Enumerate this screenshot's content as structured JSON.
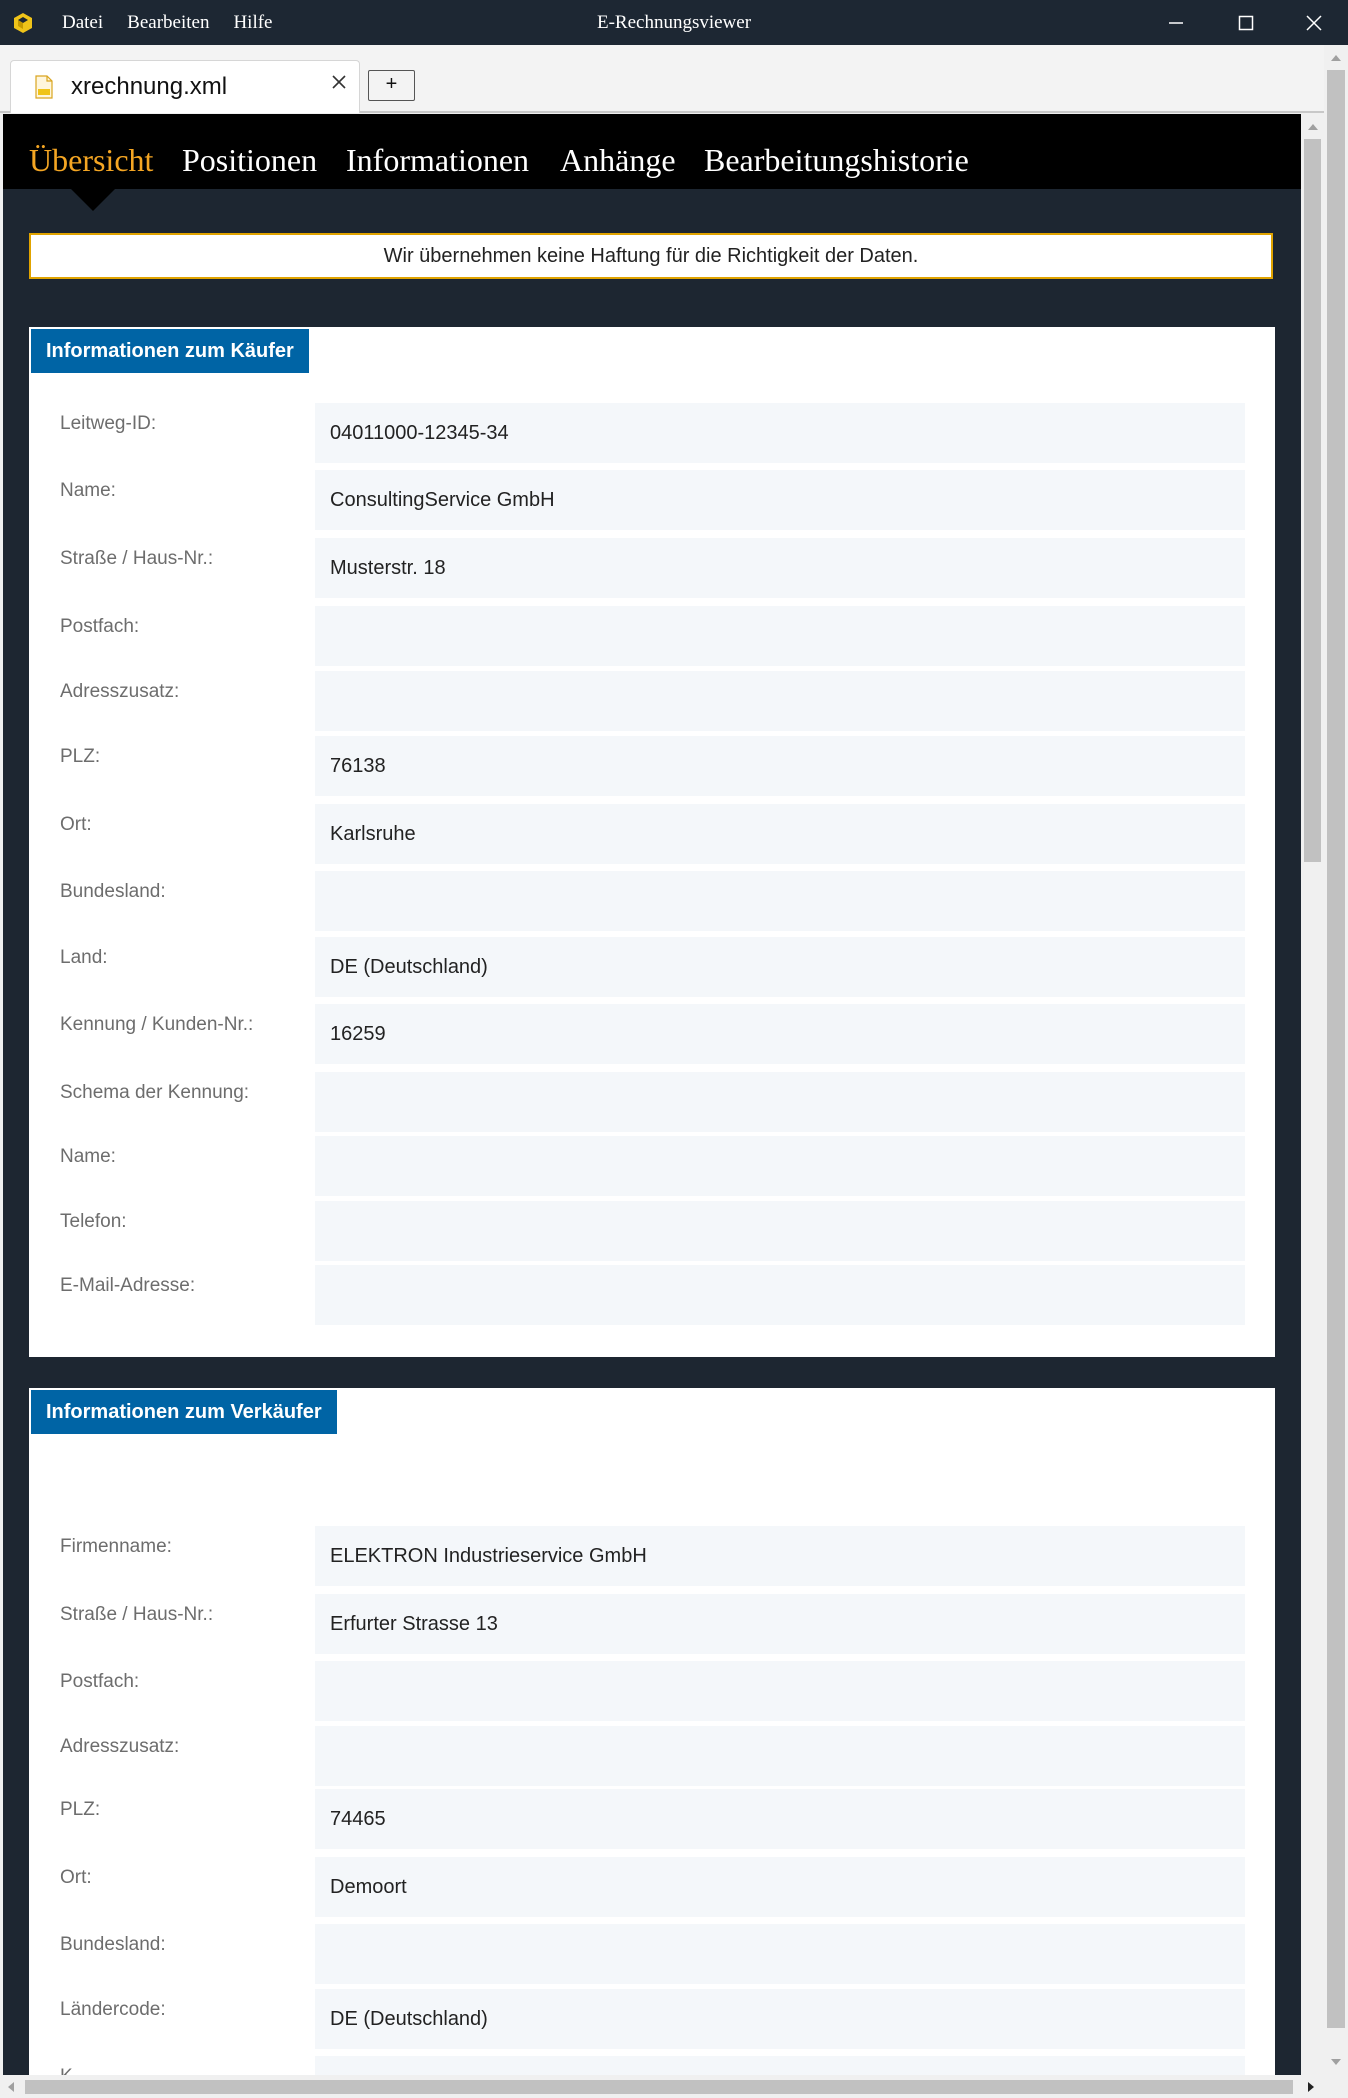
{
  "window": {
    "title": "E-Rechnungsviewer",
    "menu": [
      "Datei",
      "Bearbeiten",
      "Hilfe"
    ]
  },
  "tabs": {
    "file_tab": "xrechnung.xml",
    "add_label": "+"
  },
  "nav": {
    "items": [
      "Übersicht",
      "Positionen",
      "Informationen",
      "Anhänge",
      "Bearbeitungshistorie"
    ],
    "active": "Übersicht",
    "accent_color": "#f5a623"
  },
  "disclaimer": "Wir übernehmen keine Haftung für die Richtigkeit der Daten.",
  "buyer": {
    "title": "Informationen zum Käufer",
    "rows": [
      {
        "label": "Leitweg-ID:",
        "value": "04011000-12345-34"
      },
      {
        "label": "Name:",
        "value": "ConsultingService GmbH"
      },
      {
        "label": "Straße / Haus-Nr.:",
        "value": "Musterstr. 18"
      },
      {
        "label": "Postfach:",
        "value": ""
      },
      {
        "label": "Adresszusatz:",
        "value": ""
      },
      {
        "label": "PLZ:",
        "value": "76138"
      },
      {
        "label": "Ort:",
        "value": "Karlsruhe"
      },
      {
        "label": "Bundesland:",
        "value": ""
      },
      {
        "label": "Land:",
        "value": "DE (Deutschland)"
      },
      {
        "label": "Kennung / Kunden-Nr.:",
        "value": "16259"
      },
      {
        "label": "Schema der Kennung:",
        "value": ""
      },
      {
        "label": "Name:",
        "value": ""
      },
      {
        "label": "Telefon:",
        "value": ""
      },
      {
        "label": "E-Mail-Adresse:",
        "value": ""
      }
    ]
  },
  "seller": {
    "title": "Informationen zum Verkäufer",
    "rows": [
      {
        "label": "Firmenname:",
        "value": "ELEKTRON Industrieservice GmbH"
      },
      {
        "label": "Straße / Haus-Nr.:",
        "value": "Erfurter Strasse 13"
      },
      {
        "label": "Postfach:",
        "value": ""
      },
      {
        "label": "Adresszusatz:",
        "value": ""
      },
      {
        "label": "PLZ:",
        "value": "74465"
      },
      {
        "label": "Ort:",
        "value": "Demoort"
      },
      {
        "label": "Bundesland:",
        "value": ""
      },
      {
        "label": "Ländercode:",
        "value": "DE (Deutschland)"
      },
      {
        "label": "K...",
        "value": ""
      }
    ]
  },
  "colors": {
    "titlebar": "#1d2733",
    "section_header": "#0064a5",
    "disclaimer_border": "#e0a300"
  }
}
